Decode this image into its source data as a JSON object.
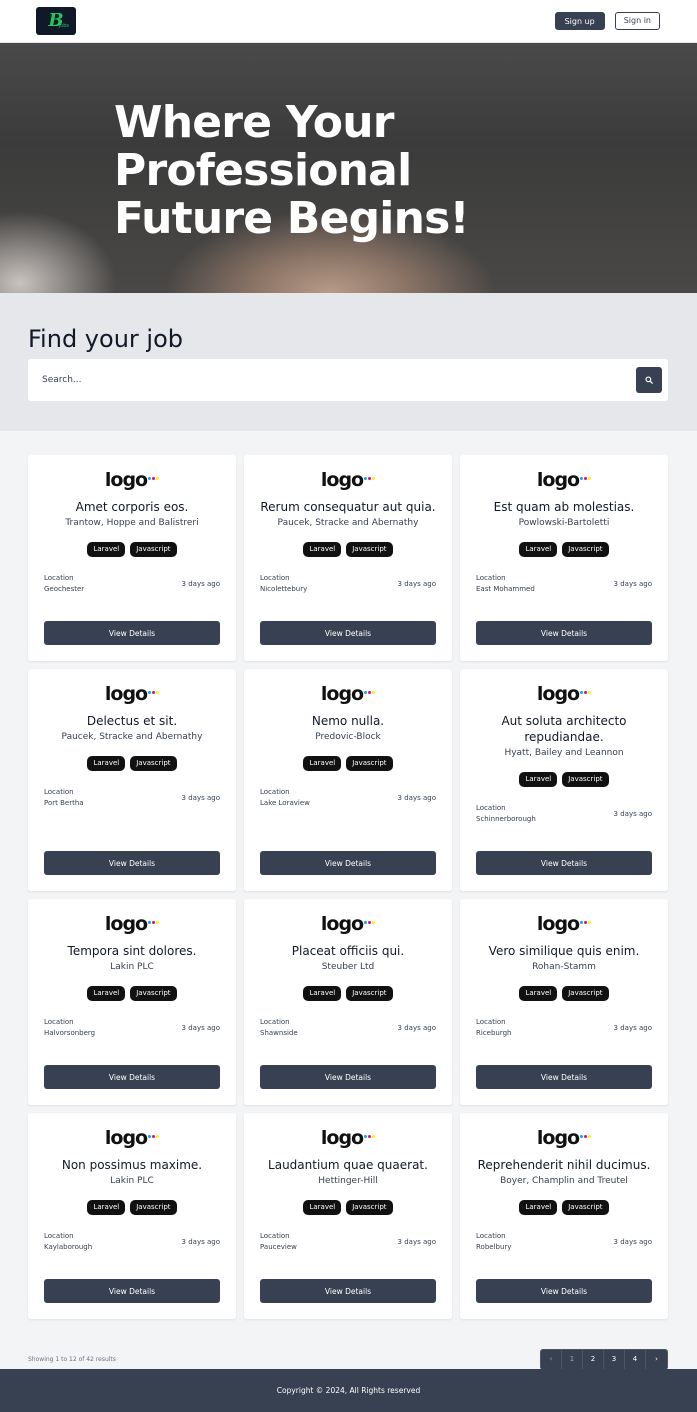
{
  "nav": {
    "brand_letter": "B",
    "brand_suffix": "jobs",
    "signup_label": "Sign up",
    "signin_label": "Sign in"
  },
  "hero": {
    "title": "Where Your Professional Future Begins!"
  },
  "search": {
    "title": "Find your job",
    "placeholder": "Search...",
    "button_icon": "search-icon"
  },
  "jobs": [
    {
      "title": "Amet corporis eos.",
      "company": "Trantow, Hoppe and Balistreri",
      "tags": [
        "Laravel",
        "Javascript"
      ],
      "location_label": "Location",
      "location": "Geochester",
      "posted": "3 days ago",
      "button": "View Details"
    },
    {
      "title": "Rerum consequatur aut quia.",
      "company": "Paucek, Stracke and Abernathy",
      "tags": [
        "Laravel",
        "Javascript"
      ],
      "location_label": "Location",
      "location": "Nicolettebury",
      "posted": "3 days ago",
      "button": "View Details"
    },
    {
      "title": "Est quam ab molestias.",
      "company": "Powlowski-Bartoletti",
      "tags": [
        "Laravel",
        "Javascript"
      ],
      "location_label": "Location",
      "location": "East Mohammed",
      "posted": "3 days ago",
      "button": "View Details"
    },
    {
      "title": "Delectus et sit.",
      "company": "Paucek, Stracke and Abernathy",
      "tags": [
        "Laravel",
        "Javascript"
      ],
      "location_label": "Location",
      "location": "Port Bertha",
      "posted": "3 days ago",
      "button": "View Details"
    },
    {
      "title": "Nemo nulla.",
      "company": "Predovic-Block",
      "tags": [
        "Laravel",
        "Javascript"
      ],
      "location_label": "Location",
      "location": "Lake Loraview",
      "posted": "3 days ago",
      "button": "View Details"
    },
    {
      "title": "Aut soluta architecto repudiandae.",
      "company": "Hyatt, Bailey and Leannon",
      "tags": [
        "Laravel",
        "Javascript"
      ],
      "location_label": "Location",
      "location": "Schinnerborough",
      "posted": "3 days ago",
      "button": "View Details"
    },
    {
      "title": "Tempora sint dolores.",
      "company": "Lakin PLC",
      "tags": [
        "Laravel",
        "Javascript"
      ],
      "location_label": "Location",
      "location": "Halvorsonberg",
      "posted": "3 days ago",
      "button": "View Details"
    },
    {
      "title": "Placeat officiis qui.",
      "company": "Steuber Ltd",
      "tags": [
        "Laravel",
        "Javascript"
      ],
      "location_label": "Location",
      "location": "Shawnside",
      "posted": "3 days ago",
      "button": "View Details"
    },
    {
      "title": "Vero similique quis enim.",
      "company": "Rohan-Stamm",
      "tags": [
        "Laravel",
        "Javascript"
      ],
      "location_label": "Location",
      "location": "Riceburgh",
      "posted": "3 days ago",
      "button": "View Details"
    },
    {
      "title": "Non possimus maxime.",
      "company": "Lakin PLC",
      "tags": [
        "Laravel",
        "Javascript"
      ],
      "location_label": "Location",
      "location": "Kaylaborough",
      "posted": "3 days ago",
      "button": "View Details"
    },
    {
      "title": "Laudantium quae quaerat.",
      "company": "Hettinger-Hill",
      "tags": [
        "Laravel",
        "Javascript"
      ],
      "location_label": "Location",
      "location": "Pauceview",
      "posted": "3 days ago",
      "button": "View Details"
    },
    {
      "title": "Reprehenderit nihil ducimus.",
      "company": "Boyer, Champlin and Treutel",
      "tags": [
        "Laravel",
        "Javascript"
      ],
      "location_label": "Location",
      "location": "Robelbury",
      "posted": "3 days ago",
      "button": "View Details"
    }
  ],
  "logo_text": "logo",
  "logo_dot_colors": [
    "#00aeef",
    "#ec008c",
    "#fff200"
  ],
  "pagination": {
    "results_text": "Showing 1 to 12 of 42 results",
    "prev": "‹",
    "pages": [
      "1",
      "2",
      "3",
      "4"
    ],
    "next": "›"
  },
  "footer": {
    "copyright": "Copyright © 2024, All Rights reserved"
  }
}
